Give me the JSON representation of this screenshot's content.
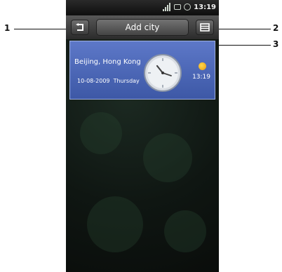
{
  "status_bar": {
    "time": "13:19"
  },
  "title_bar": {
    "title": "Add city"
  },
  "city_card": {
    "city": "Beijing, Hong Kong",
    "date": "10-08-2009",
    "weekday": "Thursday",
    "time": "13:19"
  },
  "callouts": {
    "label_1": "1",
    "label_2": "2",
    "label_3": "3"
  },
  "icons": [
    "back-icon",
    "menu-icon",
    "signal-icon",
    "battery-icon",
    "alarm-icon",
    "day-sun-icon",
    "analog-clock-icon"
  ]
}
